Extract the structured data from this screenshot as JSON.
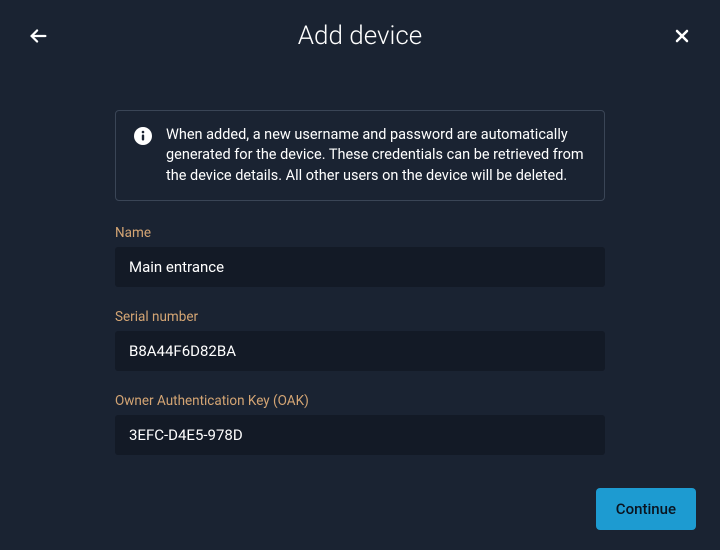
{
  "header": {
    "title": "Add device"
  },
  "info": {
    "message": "When added, a new username and password are automatically generated for the device. These credentials can be retrieved from the device details. All other users on the device will be deleted."
  },
  "fields": {
    "name": {
      "label": "Name",
      "value": "Main entrance"
    },
    "serial": {
      "label": "Serial number",
      "value": "B8A44F6D82BA"
    },
    "oak": {
      "label": "Owner Authentication Key (OAK)",
      "value": "3EFC-D4E5-978D"
    }
  },
  "actions": {
    "continue_label": "Continue"
  }
}
